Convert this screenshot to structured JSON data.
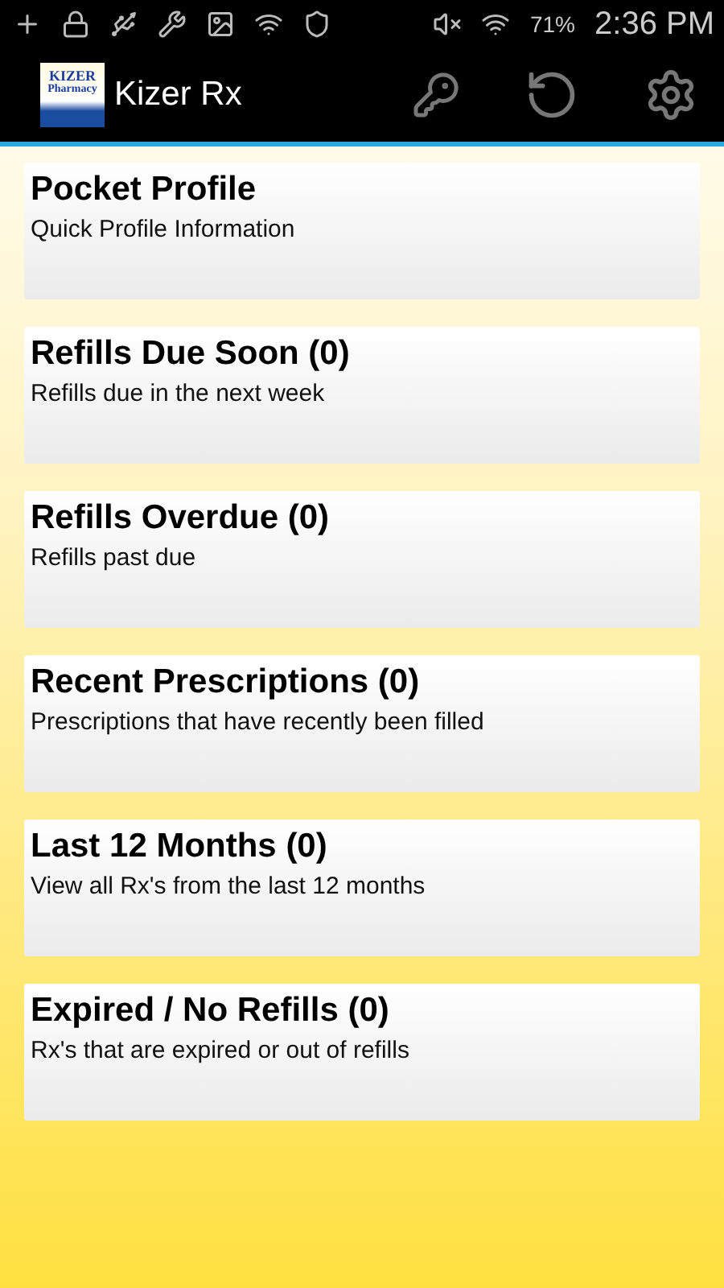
{
  "status_bar": {
    "battery": "71%",
    "time": "2:36 PM"
  },
  "action_bar": {
    "logo": {
      "line1": "KIZER",
      "line2": "Pharmacy"
    },
    "title": "Kizer Rx"
  },
  "menu": [
    {
      "title": "Pocket Profile",
      "subtitle": "Quick Profile Information"
    },
    {
      "title": "Refills Due Soon (0)",
      "subtitle": "Refills due in the next week"
    },
    {
      "title": "Refills Overdue (0)",
      "subtitle": "Refills past due"
    },
    {
      "title": "Recent Prescriptions (0)",
      "subtitle": "Prescriptions that have recently been filled"
    },
    {
      "title": "Last 12 Months (0)",
      "subtitle": "View all Rx's from the last 12 months"
    },
    {
      "title": "Expired / No Refills (0)",
      "subtitle": "Rx's that are expired or out of refills"
    }
  ]
}
